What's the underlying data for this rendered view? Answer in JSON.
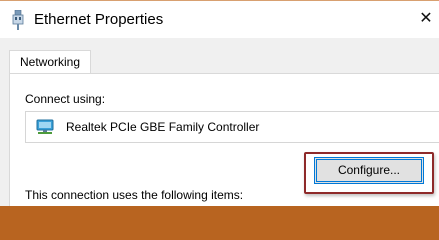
{
  "window": {
    "title": "Ethernet Properties",
    "close_symbol": "✕",
    "title_icon": "network-adapter-icon"
  },
  "tabs": [
    {
      "label": "Networking",
      "selected": true
    }
  ],
  "networking": {
    "connect_using_label": "Connect using:",
    "adapter": {
      "name": "Realtek PCIe GBE Family Controller",
      "icon": "network-card-icon"
    },
    "configure_label": "Configure...",
    "items_label": "This connection uses the following items:"
  },
  "colors": {
    "background_accent": "#b86420",
    "focus_border": "#0078d7",
    "highlight_outline": "#8e2a2a"
  }
}
